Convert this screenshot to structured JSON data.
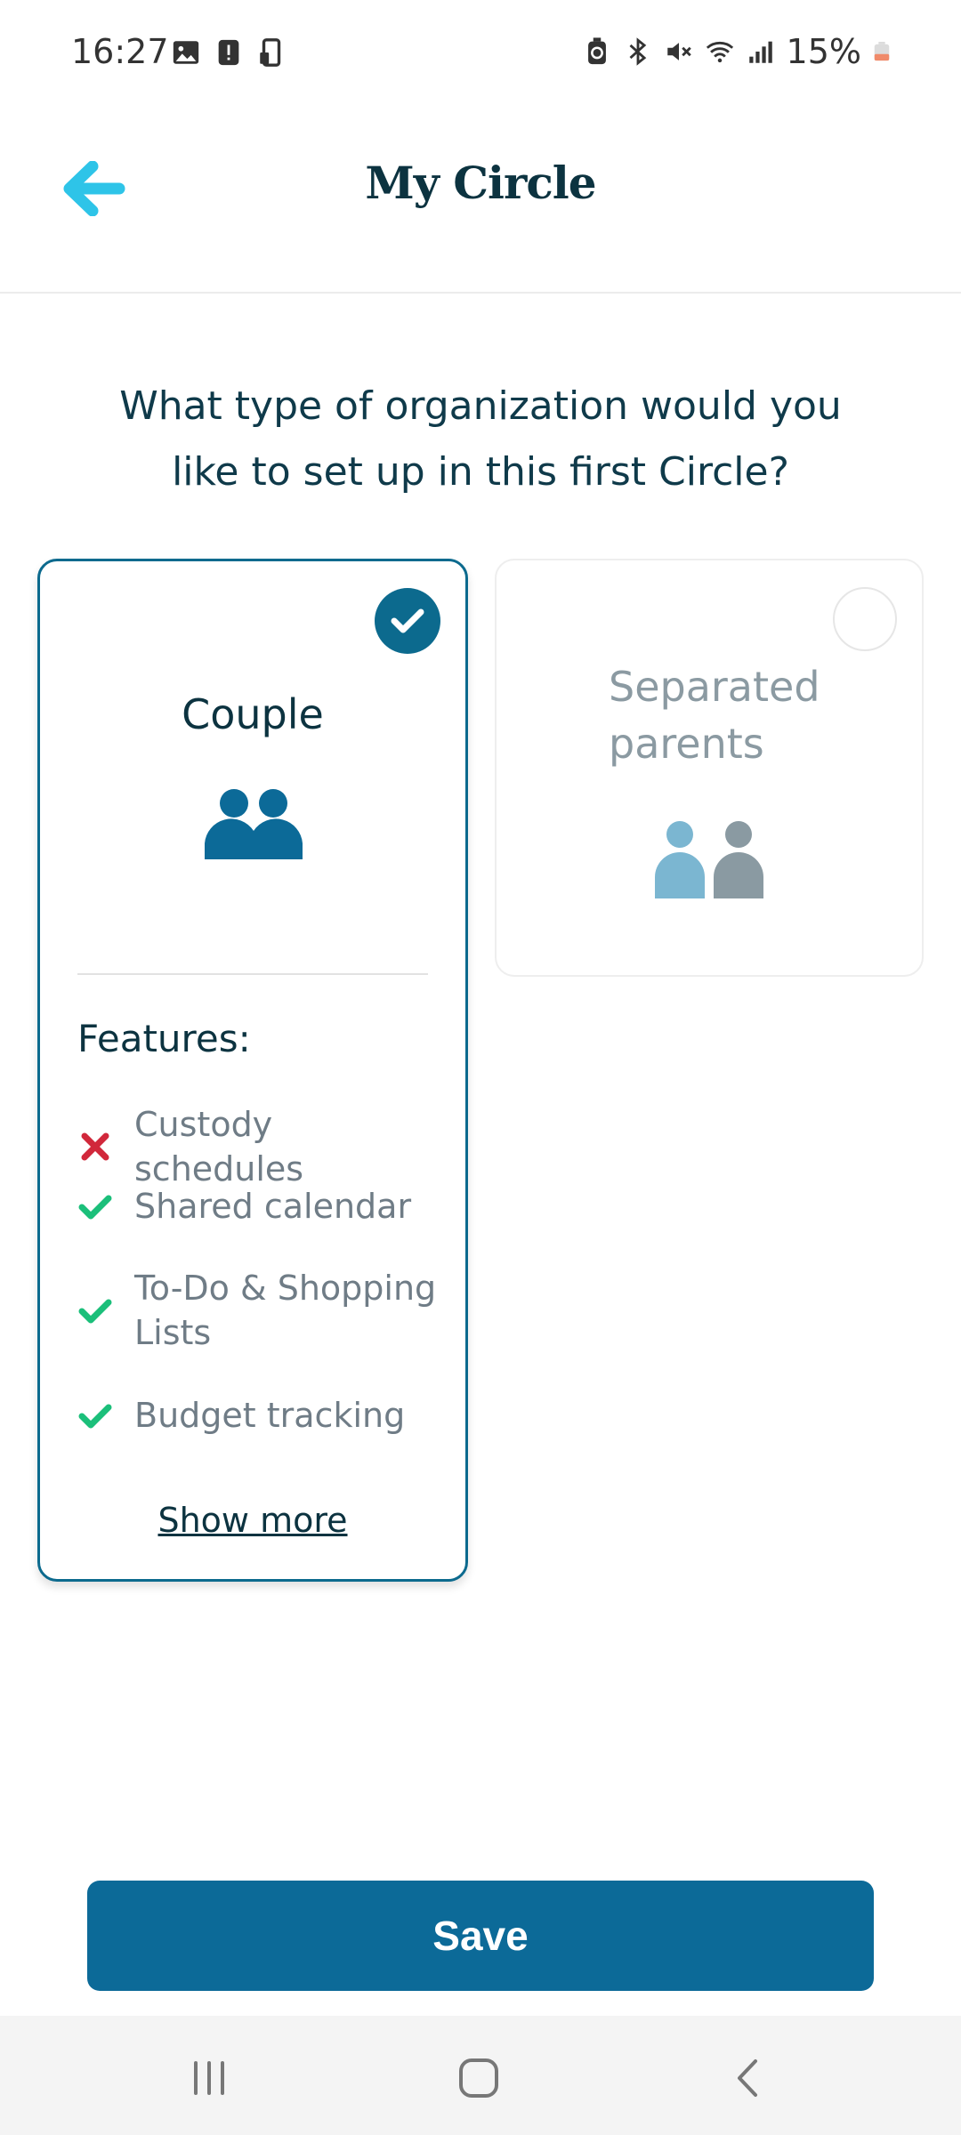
{
  "status_bar": {
    "time": "16:27",
    "battery_text": "15%",
    "left_icons": [
      "gallery-icon",
      "alert-icon",
      "phone-sync-icon"
    ],
    "right_icons": [
      "battery-saver-icon",
      "bluetooth-icon",
      "mute-icon",
      "wifi-icon",
      "signal-icon",
      "battery-icon"
    ]
  },
  "header": {
    "title": "My Circle",
    "back_icon": "arrow-left-icon",
    "accent_color": "#2ec4e8"
  },
  "question": "What type of organization would you like to set up in this first Circle?",
  "options": [
    {
      "id": "couple",
      "title": "Couple",
      "selected": true,
      "features_heading": "Features:",
      "features": [
        {
          "label": "Custody schedules",
          "included": false
        },
        {
          "label": "Shared calendar",
          "included": true
        },
        {
          "label": "To-Do & Shopping Lists",
          "included": true
        },
        {
          "label": "Budget tracking",
          "included": true
        }
      ],
      "show_more": "Show more"
    },
    {
      "id": "separated",
      "title": "Separated parents",
      "selected": false
    }
  ],
  "save_label": "Save",
  "colors": {
    "primary": "#0c6a98",
    "selected_border": "#0c6a8e",
    "check_green": "#1bbf7a",
    "cross_red": "#d1283b",
    "muted_text": "#8b9aa2"
  },
  "nav_bar": {
    "recents": "recents-icon",
    "home": "home-icon",
    "back": "back-icon"
  }
}
